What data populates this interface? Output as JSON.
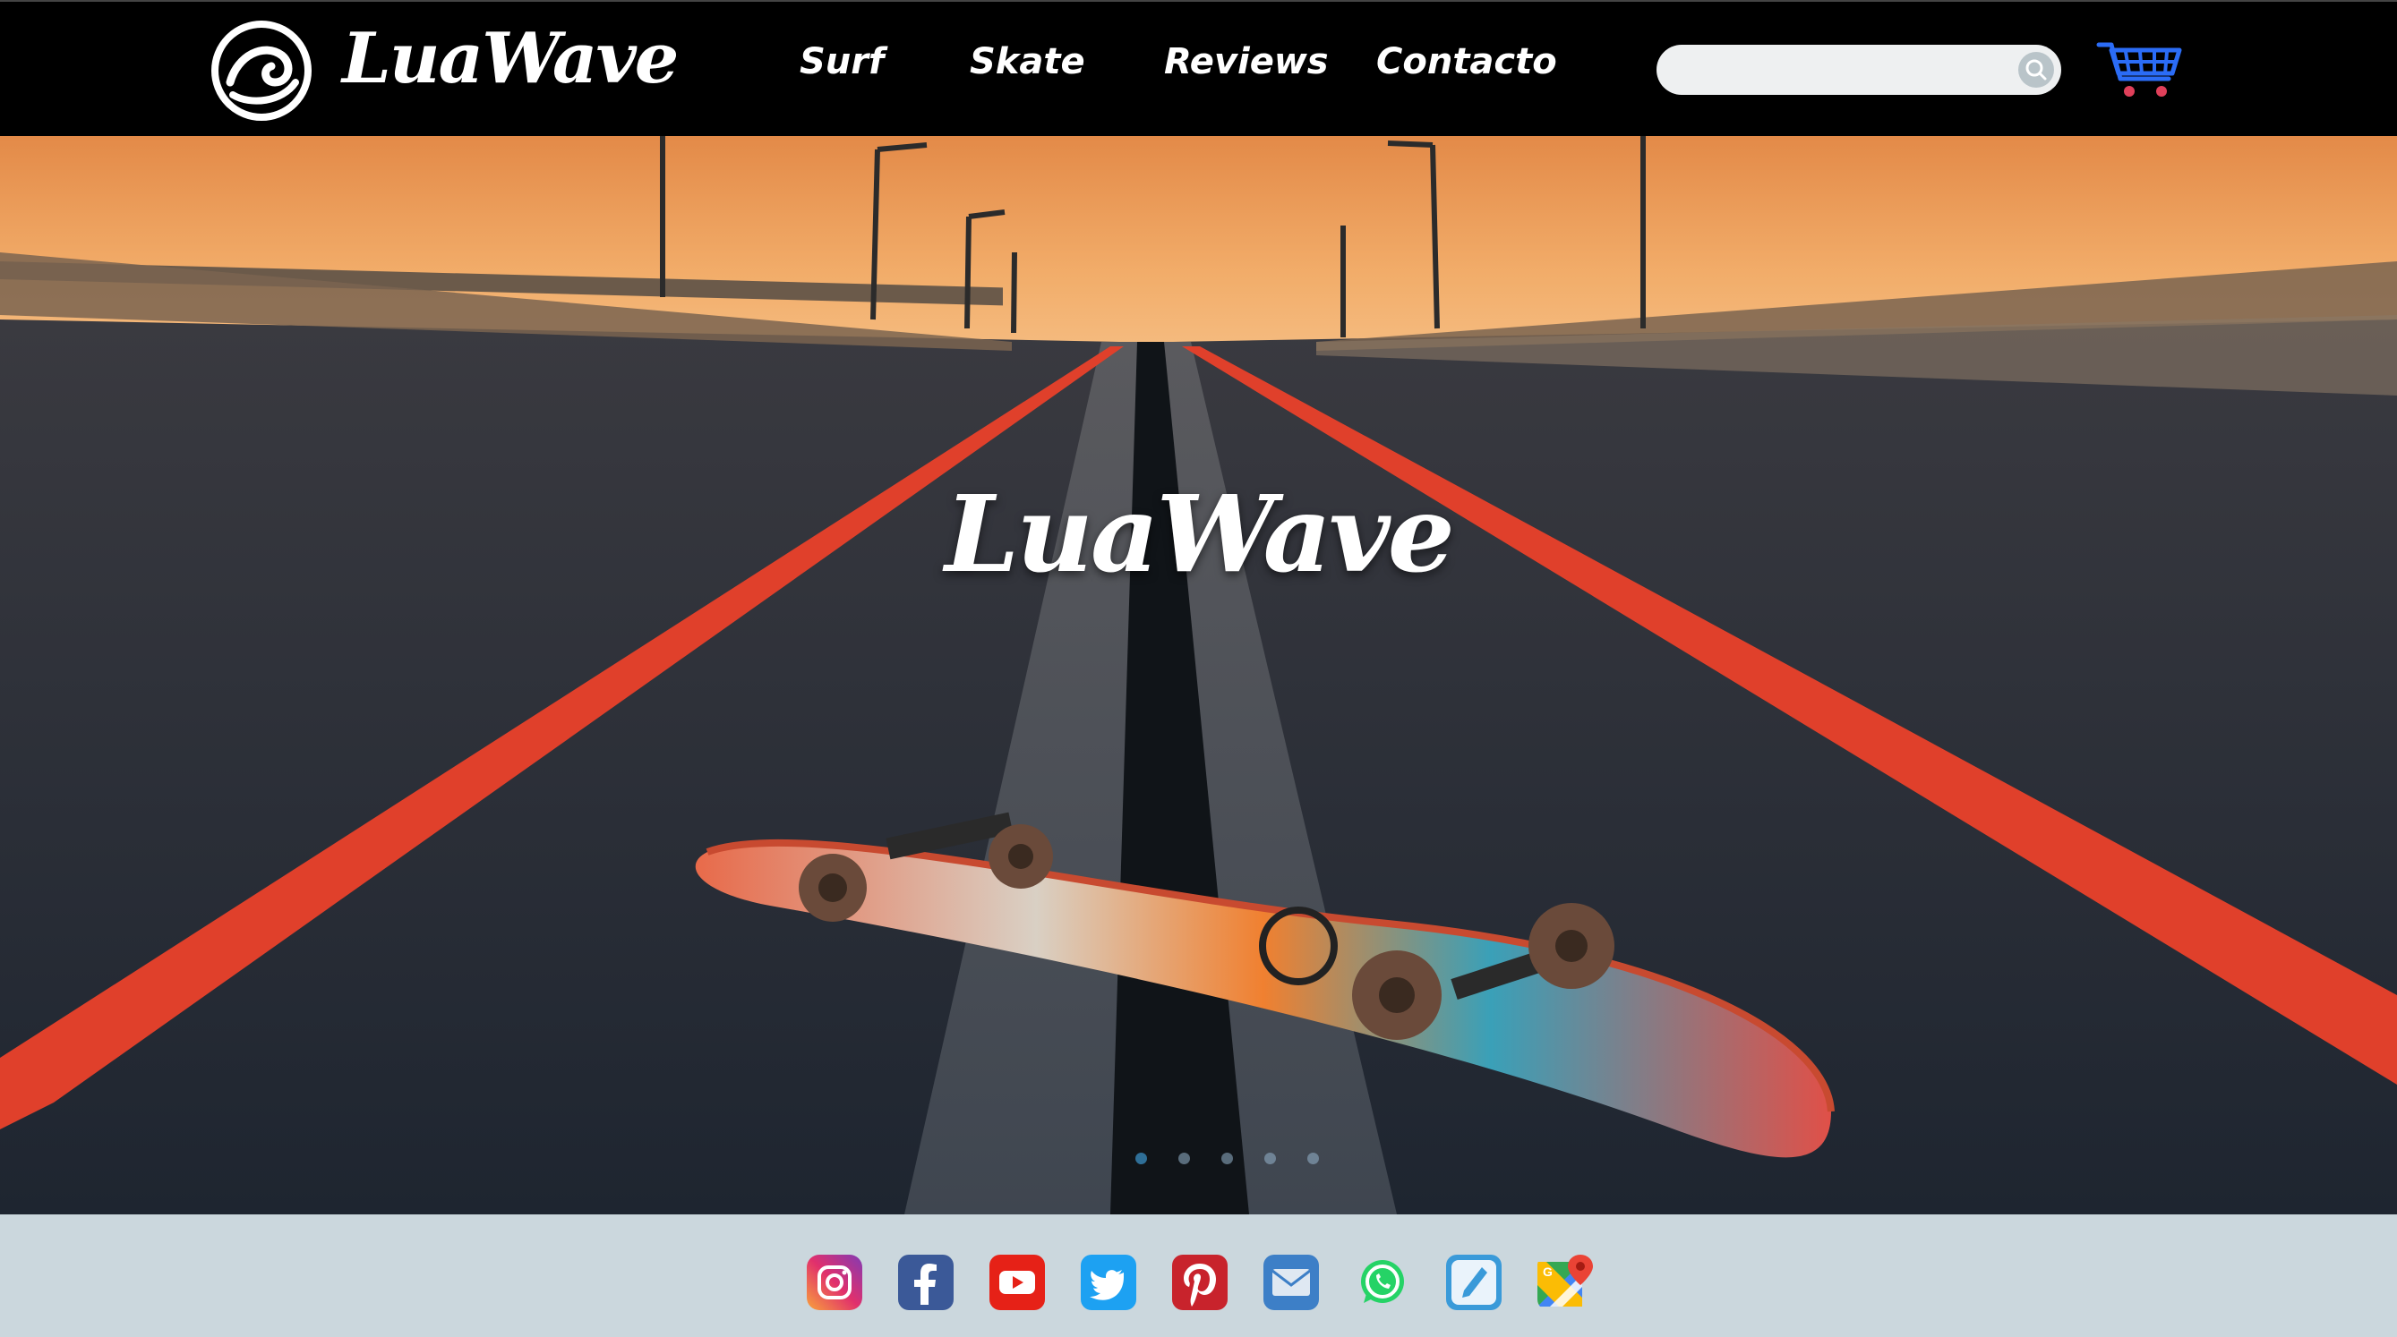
{
  "header": {
    "brand": "LuaWave",
    "nav": [
      {
        "label": "Surf"
      },
      {
        "label": "Skate"
      },
      {
        "label": "Reviews"
      },
      {
        "label": "Contacto"
      }
    ],
    "search": {
      "value": "",
      "placeholder": ""
    },
    "icons": {
      "logo": "wave-logo-icon",
      "search": "search-icon",
      "cart": "shopping-cart-icon"
    }
  },
  "hero": {
    "title": "LuaWave",
    "slides": 5,
    "active_slide": 1
  },
  "social": [
    {
      "name": "instagram-icon",
      "color": "#d6249f"
    },
    {
      "name": "facebook-icon",
      "color": "#3b5998"
    },
    {
      "name": "youtube-icon",
      "color": "#e62117"
    },
    {
      "name": "twitter-icon",
      "color": "#1da1f2"
    },
    {
      "name": "pinterest-icon",
      "color": "#c8232c"
    },
    {
      "name": "email-icon",
      "color": "#4a90d9"
    },
    {
      "name": "whatsapp-icon",
      "color": "#25d366"
    },
    {
      "name": "phone-icon",
      "color": "#3a9ad9"
    },
    {
      "name": "google-maps-icon",
      "color": "#ea4335"
    }
  ],
  "colors": {
    "header_bg": "#000000",
    "social_bar_bg": "#cbd7dd",
    "road_stripe": "#e0402b",
    "sky": "#f0a35a"
  }
}
